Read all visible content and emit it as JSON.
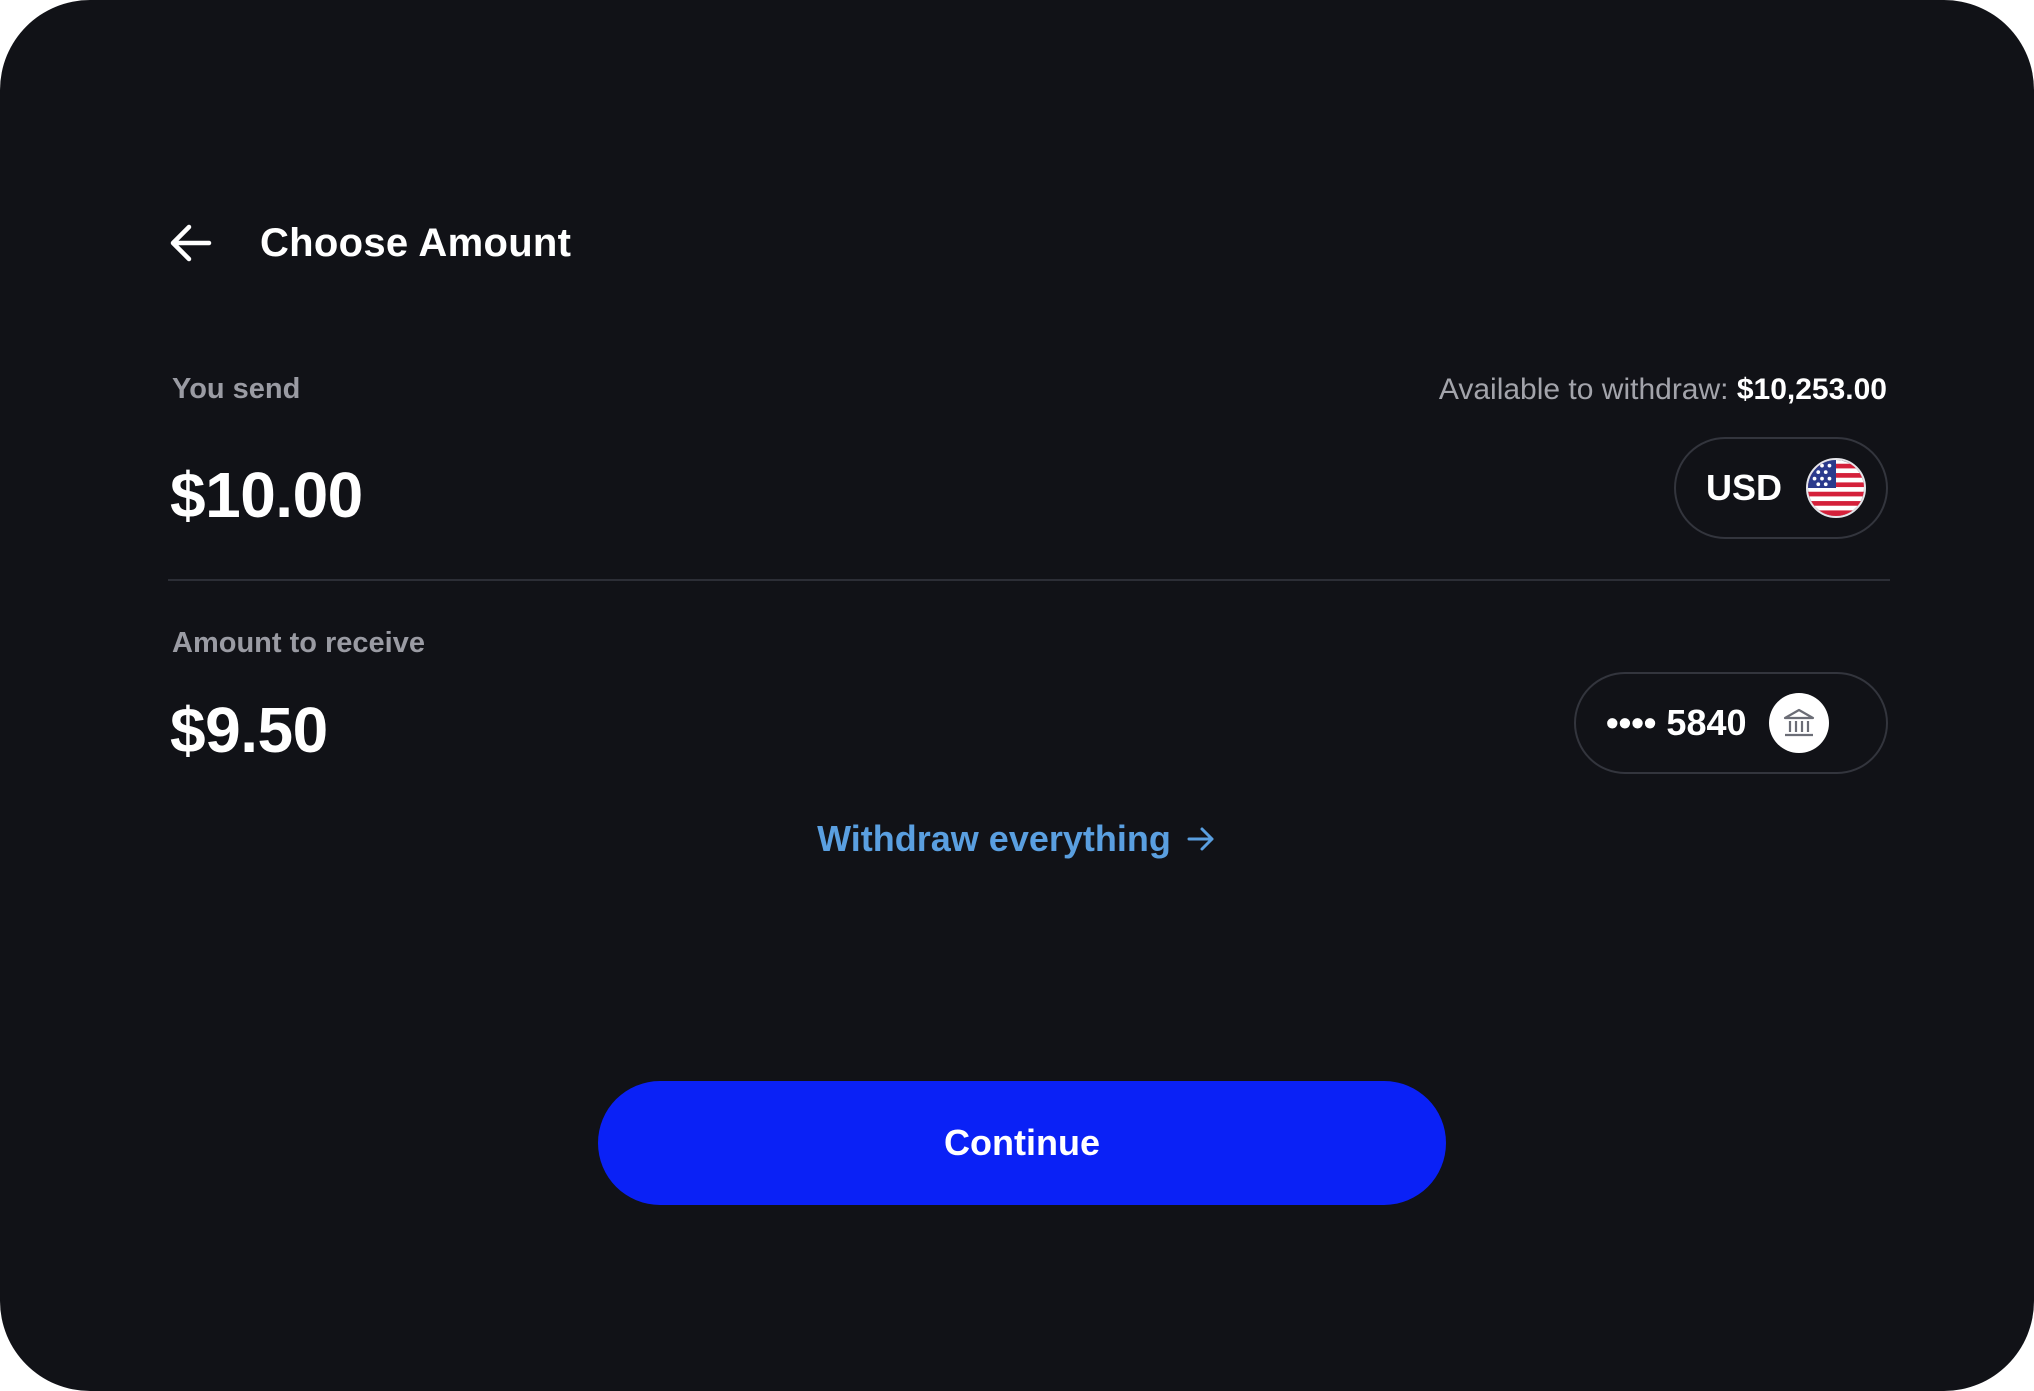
{
  "header": {
    "title": "Choose Amount",
    "back_icon": "arrow-left-icon"
  },
  "send": {
    "label": "You send",
    "available_label": "Available to withdraw:",
    "available_value": "$10,253.00",
    "amount": "$10.00",
    "currency": "USD",
    "currency_icon": "us-flag-icon"
  },
  "receive": {
    "label": "Amount to receive",
    "amount": "$9.50",
    "account_mask": "•••• 5840",
    "account_icon": "bank-icon"
  },
  "withdraw_everything": {
    "label": "Withdraw everything",
    "icon": "arrow-right-icon"
  },
  "continue": {
    "label": "Continue"
  },
  "colors": {
    "background": "#111217",
    "primary": "#0a21f6",
    "link": "#5a9fe0",
    "muted": "#9a9ba3",
    "border": "#33353d"
  }
}
